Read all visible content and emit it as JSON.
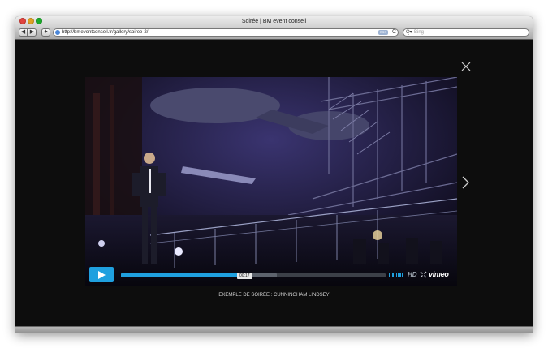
{
  "window": {
    "title": "Soirée | BM event conseil"
  },
  "toolbar": {
    "back_label": "◀",
    "forward_label": "▶",
    "add_label": "+",
    "url": "http://bmeventconseil.fr/gallery/soiree-2/",
    "rss_label": "RSS",
    "reload_label": "C",
    "search_placeholder": "Bing"
  },
  "player": {
    "time": "00:17",
    "progress": 0.47,
    "buffered": 0.59,
    "volume_bars": 10,
    "hd_label": "HD",
    "logo": "vimeo",
    "accent": "#1fa0df"
  },
  "caption": "EXEMPLE DE SOIRÉE : CUNNINGHAM LINDSEY",
  "colors": {
    "page_bg": "#0d0d0d"
  },
  "icons": {
    "close": "close-icon",
    "next": "chevron-right-icon",
    "fullscreen": "fullscreen-icon",
    "play": "play-icon"
  }
}
